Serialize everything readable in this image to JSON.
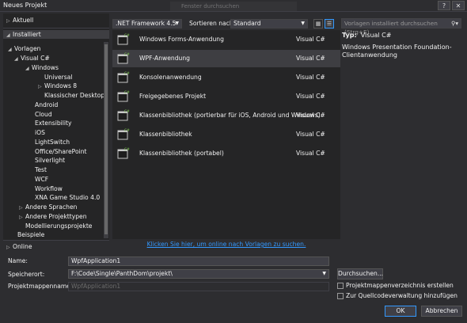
{
  "window": {
    "title": "Neues Projekt",
    "ghost_tab": "Fenster durchsuchen",
    "help_button": "?",
    "close_button": "✕"
  },
  "tree": {
    "recent": "Aktuell",
    "installed": "Installiert",
    "templates": "Vorlagen",
    "visual_csharp": "Visual C#",
    "windows": "Windows",
    "universal": "Universal",
    "windows8": "Windows 8",
    "classic_desktop": "Klassischer Desktop",
    "android": "Android",
    "cloud": "Cloud",
    "extensibility": "Extensibility",
    "ios": "iOS",
    "lightswitch": "LightSwitch",
    "office_sharepoint": "Office/SharePoint",
    "silverlight": "Silverlight",
    "test": "Test",
    "wcf": "WCF",
    "workflow": "Workflow",
    "xna": "XNA Game Studio 4.0",
    "other_languages": "Andere Sprachen",
    "other_project_types": "Andere Projekttypen",
    "modeling_projects": "Modellierungsprojekte",
    "samples": "Beispiele",
    "online": "Online"
  },
  "toolbar": {
    "framework": ".NET Framework 4.5",
    "sort_label": "Sortieren nach:",
    "sort_value": "Standard",
    "search_placeholder": "Vorlagen installiert durchsuchen (Strg+E)"
  },
  "templates": [
    {
      "name": "Windows Forms-Anwendung",
      "lang": "Visual C#"
    },
    {
      "name": "WPF-Anwendung",
      "lang": "Visual C#"
    },
    {
      "name": "Konsolenanwendung",
      "lang": "Visual C#"
    },
    {
      "name": "Freigegebenes Projekt",
      "lang": "Visual C#"
    },
    {
      "name": "Klassenbibliothek (portierbar für iOS, Android und Windows)",
      "lang": "Visual C#"
    },
    {
      "name": "Klassenbibliothek",
      "lang": "Visual C#"
    },
    {
      "name": "Klassenbibliothek (portabel)",
      "lang": "Visual C#"
    }
  ],
  "online_link": "Klicken Sie hier, um online nach Vorlagen zu suchen.",
  "details": {
    "type_label": "Typ:",
    "type_value": "Visual C#",
    "description": "Windows Presentation Foundation-Clientanwendung"
  },
  "form": {
    "name_label": "Name:",
    "name_value": "WpfApplication1",
    "location_label": "Speicherort:",
    "location_value": "F:\\Code\\Single\\PanthDom\\projekt\\",
    "solution_label": "Projektmappenname:",
    "solution_value": "WpfApplication1",
    "browse_button": "Durchsuchen...",
    "create_dir_label": "Projektmappenverzeichnis erstellen",
    "source_control_label": "Zur Quellcodeverwaltung hinzufügen",
    "ok_button": "OK",
    "cancel_button": "Abbrechen"
  },
  "colors": {
    "accent": "#3399ff",
    "background": "#2d2d30",
    "panel": "#252526",
    "selection": "#3e3e42"
  }
}
